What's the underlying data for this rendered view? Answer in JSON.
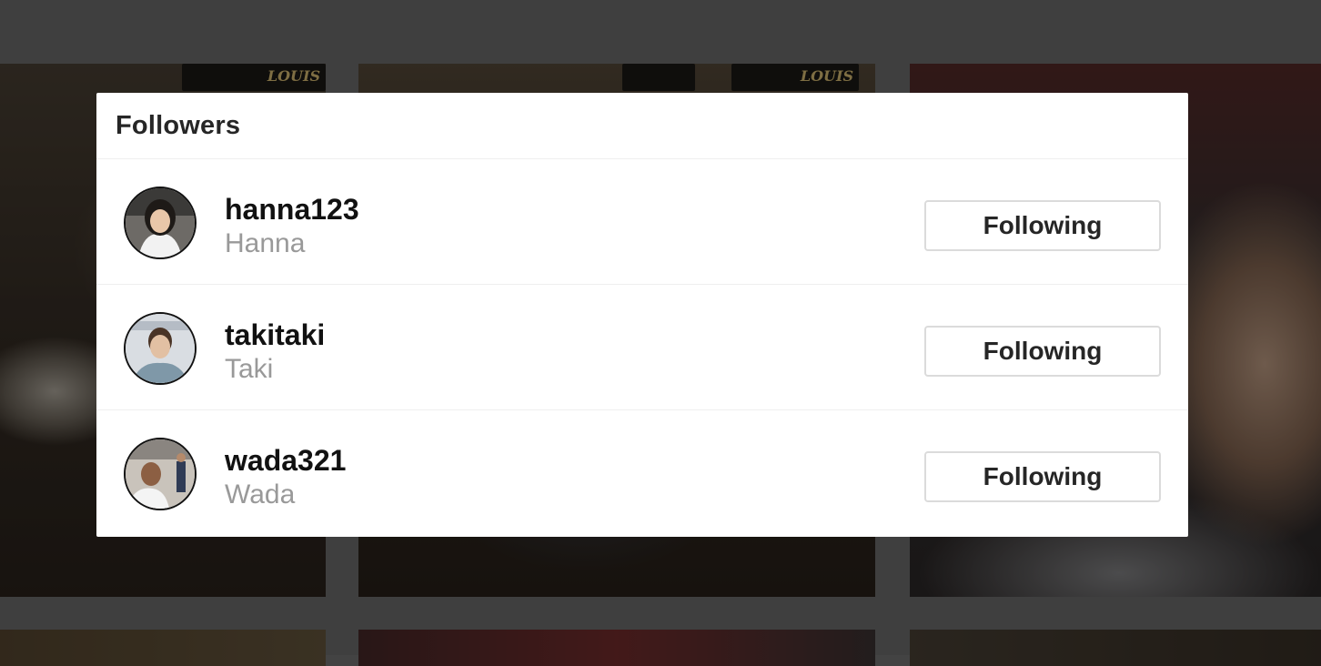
{
  "modal": {
    "title": "Followers"
  },
  "followers": [
    {
      "username": "hanna123",
      "full_name": "Hanna",
      "button_label": "Following"
    },
    {
      "username": "takitaki",
      "full_name": "Taki",
      "button_label": "Following"
    },
    {
      "username": "wada321",
      "full_name": "Wada",
      "button_label": "Following"
    }
  ],
  "background": {
    "sign_text": "LOUIS"
  }
}
